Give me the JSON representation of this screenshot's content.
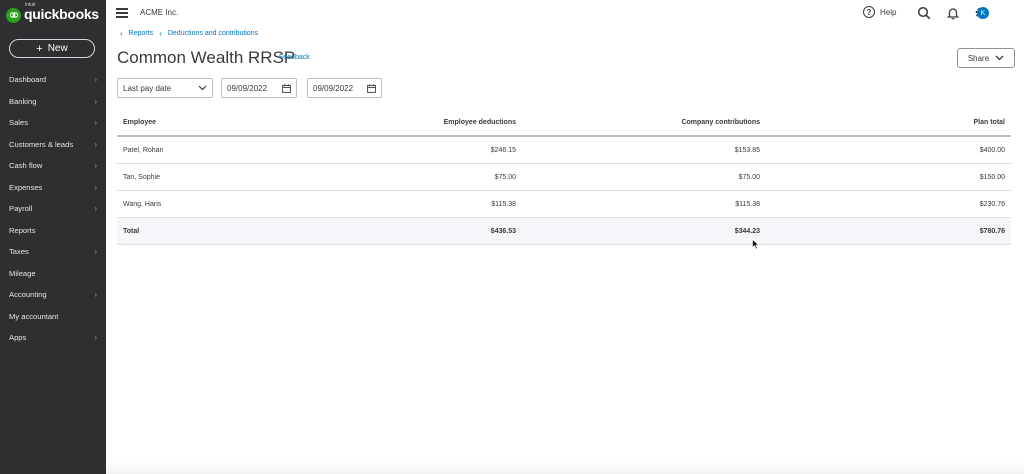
{
  "sidebar": {
    "logo_small": "intuit",
    "logo": "quickbooks",
    "new_label": "New",
    "items": [
      {
        "label": "Dashboard",
        "chevron": true
      },
      {
        "label": "Banking",
        "chevron": true
      },
      {
        "label": "Sales",
        "chevron": true
      },
      {
        "label": "Customers & leads",
        "chevron": true
      },
      {
        "label": "Cash flow",
        "chevron": true
      },
      {
        "label": "Expenses",
        "chevron": true
      },
      {
        "label": "Payroll",
        "chevron": true
      },
      {
        "label": "Reports",
        "chevron": false
      },
      {
        "label": "Taxes",
        "chevron": true
      },
      {
        "label": "Mileage",
        "chevron": false
      },
      {
        "label": "Accounting",
        "chevron": true
      },
      {
        "label": "My accountant",
        "chevron": false
      },
      {
        "label": "Apps",
        "chevron": true
      }
    ]
  },
  "topbar": {
    "company": "ACME Inc.",
    "help_label": "Help",
    "avatar_initial": "K"
  },
  "breadcrumb": [
    "Reports",
    "Deductions and contributions"
  ],
  "page": {
    "title": "Common Wealth RRSP",
    "feedback": "Feedback",
    "share_label": "Share"
  },
  "filters": {
    "period": "Last pay date",
    "start_date": "09/09/2022",
    "end_date": "09/09/2022"
  },
  "table": {
    "headers": [
      "Employee",
      "Employee deductions",
      "Company contributions",
      "Plan total"
    ],
    "rows": [
      [
        "Patel, Rohan",
        "$246.15",
        "$153.85",
        "$400.00"
      ],
      [
        "Tan, Sophie",
        "$75.00",
        "$75.00",
        "$150.00"
      ],
      [
        "Wang, Haris",
        "$115.38",
        "$115.38",
        "$230.76"
      ]
    ],
    "total": [
      "Total",
      "$436.53",
      "$344.23",
      "$780.76"
    ]
  },
  "colors": {
    "sidebar_bg": "#2d2f30",
    "brand_green": "#2ca01c",
    "link_blue": "#0077c5",
    "text": "#393a3d"
  }
}
